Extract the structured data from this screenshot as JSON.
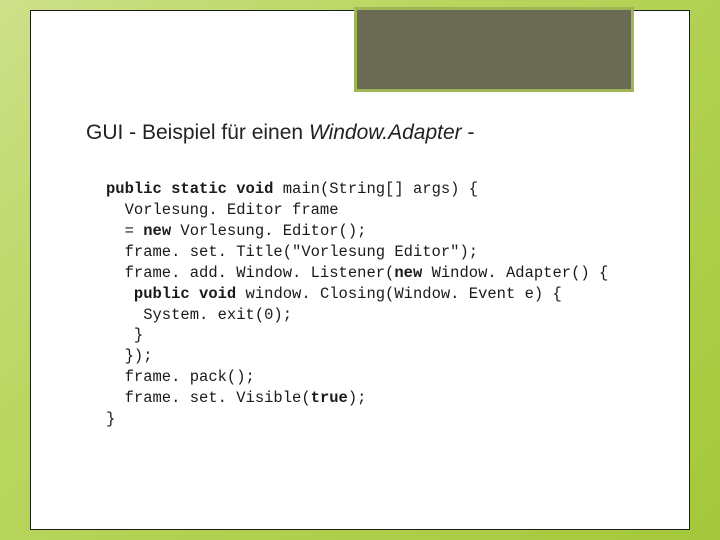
{
  "title": {
    "prefix": "GUI - Beispiel für einen ",
    "italic": "Window.Adapter",
    "suffix": " -"
  },
  "code": {
    "kw1": "public static void",
    "l1b": " main(String[] args) {",
    "l2": "  Vorlesung. Editor frame",
    "l3a": "  = ",
    "kw2": "new",
    "l3b": " Vorlesung. Editor();",
    "l4": "  frame. set. Title(\"Vorlesung Editor\");",
    "l5a": "  frame. add. Window. Listener(",
    "kw3": "new",
    "l5b": " Window. Adapter() {",
    "l6a": "   ",
    "kw4": "public void",
    "l6b": " window. Closing(Window. Event e) {",
    "l7": "    System. exit(0);",
    "l8": "   }",
    "l9": "  });",
    "l10": "  frame. pack();",
    "l11a": "  frame. set. Visible(",
    "kw5": "true",
    "l11b": ");",
    "l12": "}"
  }
}
